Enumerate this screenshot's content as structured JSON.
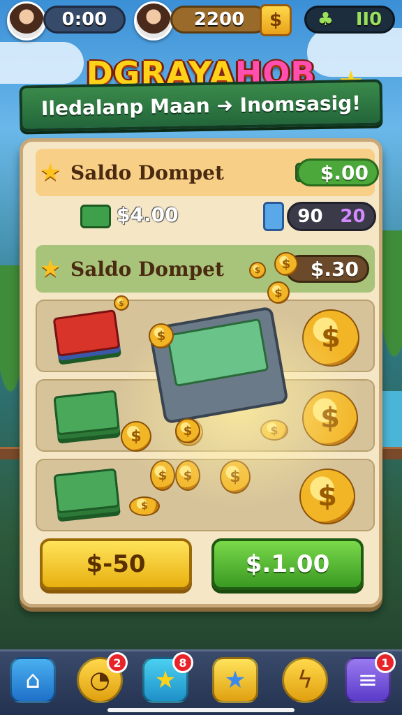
{
  "player_left": {
    "currency": "0:00"
  },
  "player_right": {
    "currency": "2200",
    "currency_icon": "$"
  },
  "top_right": {
    "icon": "♣",
    "value": "II0"
  },
  "title": {
    "main": "DGRAYA",
    "accent": "HOB"
  },
  "banner": {
    "text": "Iledalanp Maan ➜ Inomsasig!"
  },
  "wallet": {
    "row1_label": "Saldo Dompet",
    "row1_value": "$.00",
    "amount": "$4.00",
    "stat_a": "90",
    "stat_b": "20",
    "row2_label": "Saldo Dompet",
    "row2_value": "$.30"
  },
  "buttons": {
    "left": "$-50",
    "right": "$.1.00"
  },
  "nav": {
    "badges": {
      "coins": "2",
      "star": "8",
      "menu": "1"
    }
  },
  "colors": {
    "accent_yellow": "#ffd21a",
    "accent_green": "#4ca83a",
    "panel": "#f5e6c6"
  }
}
